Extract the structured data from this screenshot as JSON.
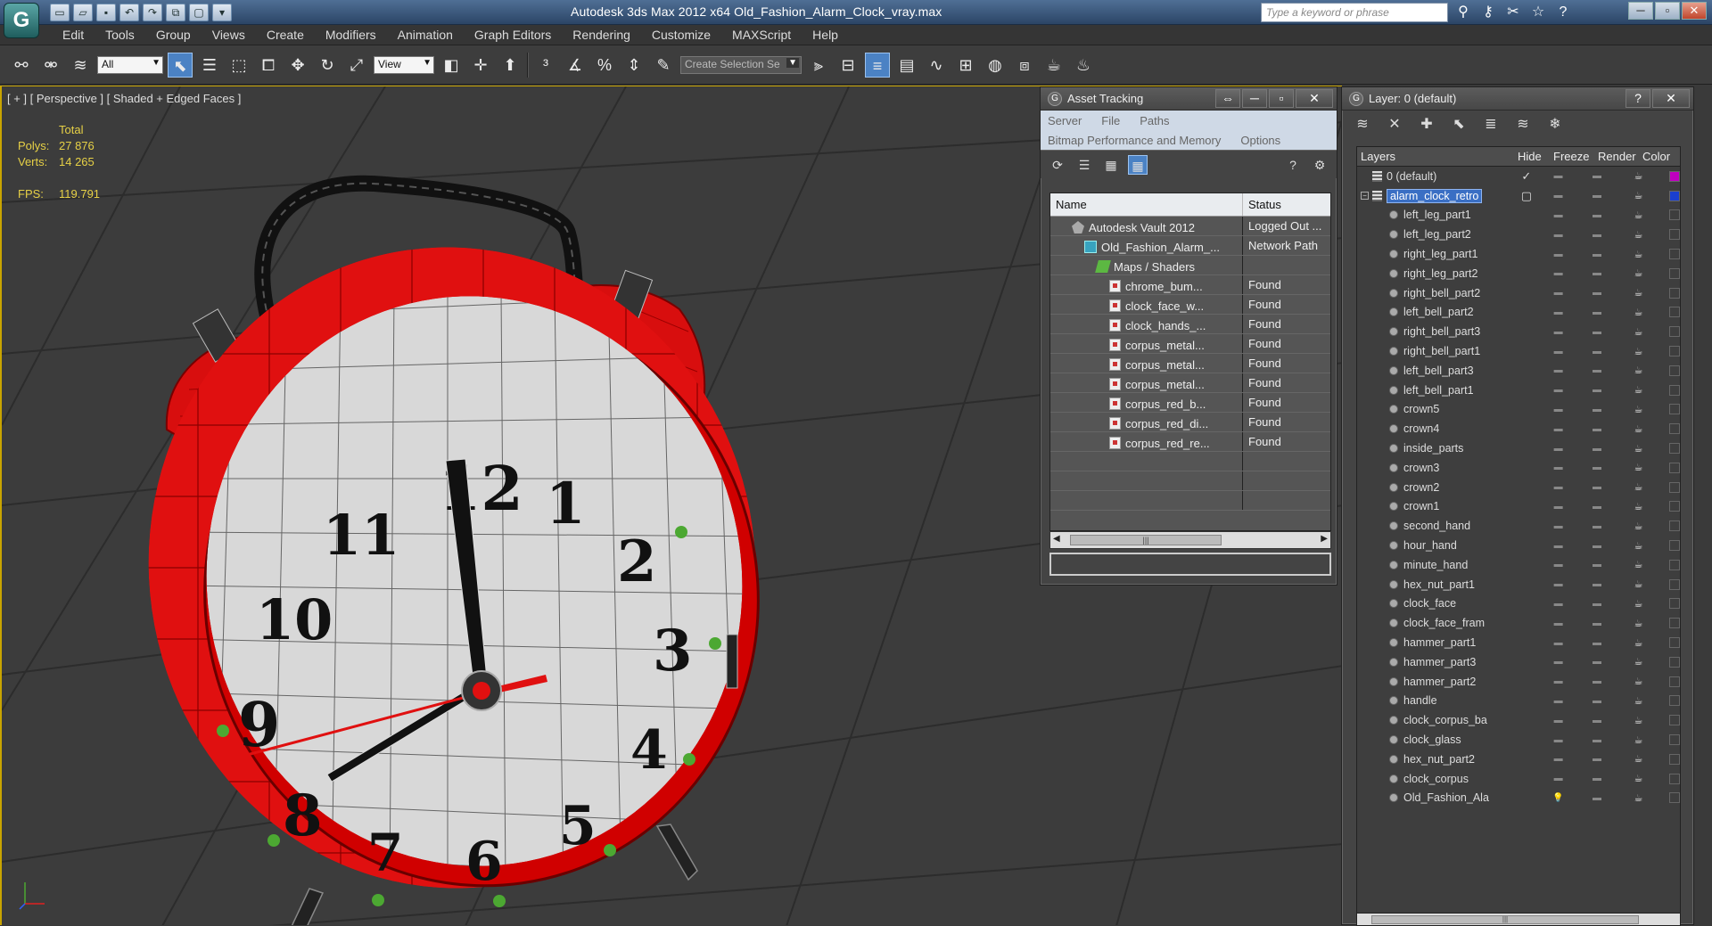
{
  "app": {
    "logo": "G",
    "title": "Autodesk 3ds Max  2012 x64     Old_Fashion_Alarm_Clock_vray.max",
    "search_placeholder": "Type a keyword or phrase"
  },
  "menu": [
    "Edit",
    "Tools",
    "Group",
    "Views",
    "Create",
    "Modifiers",
    "Animation",
    "Graph Editors",
    "Rendering",
    "Customize",
    "MAXScript",
    "Help"
  ],
  "toolbar": {
    "filter_value": "All",
    "refcoord_value": "View",
    "selection_set_placeholder": "Create Selection Se"
  },
  "viewport": {
    "label": "[ + ] [ Perspective ] [ Shaded + Edged Faces ]",
    "stats": {
      "total_label": "Total",
      "polys_label": "Polys:",
      "polys_value": "27 876",
      "verts_label": "Verts:",
      "verts_value": "14 265",
      "fps_label": "FPS:",
      "fps_value": "119.791"
    },
    "clock_numbers": [
      "12",
      "1",
      "2",
      "3",
      "4",
      "5",
      "6",
      "7",
      "8",
      "9",
      "10",
      "11"
    ],
    "colors": {
      "clock_red": "#e01010",
      "face": "#d8d8d8",
      "grid_bg": "#3c3c3c"
    }
  },
  "asset_tracking": {
    "title": "Asset Tracking",
    "menu_row1": [
      "Server",
      "File",
      "Paths"
    ],
    "menu_row2": [
      "Bitmap Performance and Memory",
      "Options"
    ],
    "columns": [
      "Name",
      "Status"
    ],
    "rows": [
      {
        "name": "Autodesk Vault 2012",
        "status": "Logged Out ...",
        "icon": "vault-icon",
        "indent": 1
      },
      {
        "name": "Old_Fashion_Alarm_...",
        "status": "Network Path",
        "icon": "max-file-icon",
        "indent": 2
      },
      {
        "name": "Maps / Shaders",
        "status": "",
        "icon": "maps-icon",
        "indent": 3
      },
      {
        "name": "chrome_bum...",
        "status": "Found",
        "icon": "bitmap-icon",
        "indent": 4
      },
      {
        "name": "clock_face_w...",
        "status": "Found",
        "icon": "bitmap-icon",
        "indent": 4
      },
      {
        "name": "clock_hands_...",
        "status": "Found",
        "icon": "bitmap-icon",
        "indent": 4
      },
      {
        "name": "corpus_metal...",
        "status": "Found",
        "icon": "bitmap-icon",
        "indent": 4
      },
      {
        "name": "corpus_metal...",
        "status": "Found",
        "icon": "bitmap-icon",
        "indent": 4
      },
      {
        "name": "corpus_metal...",
        "status": "Found",
        "icon": "bitmap-icon",
        "indent": 4
      },
      {
        "name": "corpus_red_b...",
        "status": "Found",
        "icon": "bitmap-icon",
        "indent": 4
      },
      {
        "name": "corpus_red_di...",
        "status": "Found",
        "icon": "bitmap-icon",
        "indent": 4
      },
      {
        "name": "corpus_red_re...",
        "status": "Found",
        "icon": "bitmap-icon",
        "indent": 4
      }
    ]
  },
  "layers": {
    "title": "Layer: 0 (default)",
    "columns": [
      "Layers",
      "Hide",
      "Freeze",
      "Render",
      "Color"
    ],
    "rows": [
      {
        "name": "0 (default)",
        "type": "layer",
        "check": "✓",
        "color": "#c000c0"
      },
      {
        "name": "alarm_clock_retro",
        "type": "layer",
        "selected": true,
        "color": "#1a3fd0"
      },
      {
        "name": "left_leg_part1",
        "type": "object"
      },
      {
        "name": "left_leg_part2",
        "type": "object"
      },
      {
        "name": "right_leg_part1",
        "type": "object"
      },
      {
        "name": "right_leg_part2",
        "type": "object"
      },
      {
        "name": "right_bell_part2",
        "type": "object"
      },
      {
        "name": "left_bell_part2",
        "type": "object"
      },
      {
        "name": "right_bell_part3",
        "type": "object"
      },
      {
        "name": "right_bell_part1",
        "type": "object"
      },
      {
        "name": "left_bell_part3",
        "type": "object"
      },
      {
        "name": "left_bell_part1",
        "type": "object"
      },
      {
        "name": "crown5",
        "type": "object"
      },
      {
        "name": "crown4",
        "type": "object"
      },
      {
        "name": "inside_parts",
        "type": "object"
      },
      {
        "name": "crown3",
        "type": "object"
      },
      {
        "name": "crown2",
        "type": "object"
      },
      {
        "name": "crown1",
        "type": "object"
      },
      {
        "name": "second_hand",
        "type": "object"
      },
      {
        "name": "hour_hand",
        "type": "object"
      },
      {
        "name": "minute_hand",
        "type": "object"
      },
      {
        "name": "hex_nut_part1",
        "type": "object"
      },
      {
        "name": "clock_face",
        "type": "object"
      },
      {
        "name": "clock_face_fram",
        "type": "object"
      },
      {
        "name": "hammer_part1",
        "type": "object"
      },
      {
        "name": "hammer_part3",
        "type": "object"
      },
      {
        "name": "hammer_part2",
        "type": "object"
      },
      {
        "name": "handle",
        "type": "object"
      },
      {
        "name": "clock_corpus_ba",
        "type": "object"
      },
      {
        "name": "clock_glass",
        "type": "object"
      },
      {
        "name": "hex_nut_part2",
        "type": "object"
      },
      {
        "name": "clock_corpus",
        "type": "object"
      },
      {
        "name": "Old_Fashion_Ala",
        "type": "object",
        "light": true
      }
    ]
  }
}
